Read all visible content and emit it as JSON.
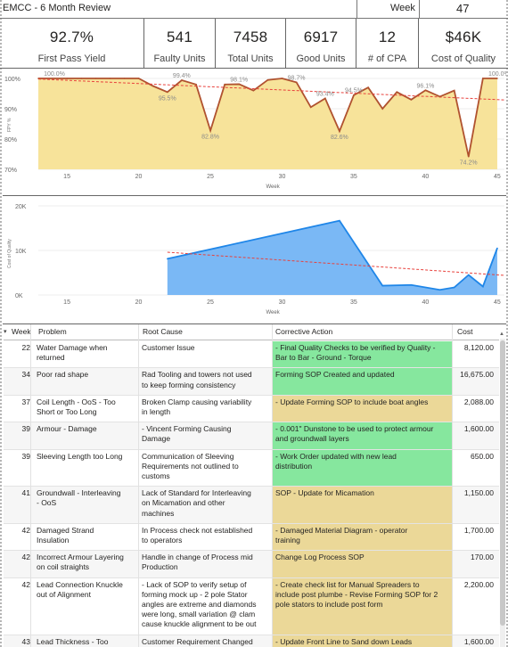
{
  "header": {
    "title": "EMCC - 6 Month Review",
    "week_label": "Week",
    "week_value": "47"
  },
  "kpis": [
    {
      "value": "92.7%",
      "label": "First Pass Yield"
    },
    {
      "value": "541",
      "label": "Faulty Units"
    },
    {
      "value": "7458",
      "label": "Total Units"
    },
    {
      "value": "6917",
      "label": "Good Units"
    },
    {
      "value": "12",
      "label": "# of CPA"
    },
    {
      "value": "$46K",
      "label": "Cost of Quality"
    }
  ],
  "colors": {
    "fpy_area": "#f7e39a",
    "fpy_line": "#b0522f",
    "trend": "#e8413c",
    "coq_area": "#7ab8f5",
    "coq_line": "#1f86e8",
    "action_green": "#86e79e",
    "action_yellow": "#ebd898"
  },
  "chart_data": [
    {
      "type": "area",
      "ylabel": "FPY %",
      "xlabel": "Week",
      "xlim": [
        13,
        45.5
      ],
      "ylim": [
        70,
        100
      ],
      "x_ticks": [
        "15",
        "20",
        "25",
        "30",
        "35",
        "40",
        "45"
      ],
      "y_ticks": [
        "100%",
        "90%",
        "80%",
        "70%"
      ],
      "trend": "dashed red line from about 99.8% (week 13) to about 93% (week 45)",
      "points": [
        {
          "x": 13,
          "y": 100.0
        },
        {
          "x": 14,
          "y": 100.0
        },
        {
          "x": 15,
          "y": 100.0
        },
        {
          "x": 16,
          "y": 100.0
        },
        {
          "x": 17,
          "y": 100.0
        },
        {
          "x": 18,
          "y": 100.0
        },
        {
          "x": 19,
          "y": 100.0
        },
        {
          "x": 20,
          "y": 100.0
        },
        {
          "x": 21,
          "y": 97.5
        },
        {
          "x": 22,
          "y": 95.5
        },
        {
          "x": 23,
          "y": 99.4
        },
        {
          "x": 24,
          "y": 98.0
        },
        {
          "x": 25,
          "y": 82.8
        },
        {
          "x": 26,
          "y": 98.0
        },
        {
          "x": 27,
          "y": 98.1
        },
        {
          "x": 28,
          "y": 96.0
        },
        {
          "x": 29,
          "y": 99.5
        },
        {
          "x": 30,
          "y": 100.0
        },
        {
          "x": 31,
          "y": 98.7
        },
        {
          "x": 32,
          "y": 90.5
        },
        {
          "x": 33,
          "y": 93.4
        },
        {
          "x": 34,
          "y": 82.6
        },
        {
          "x": 35,
          "y": 94.5
        },
        {
          "x": 36,
          "y": 97.0
        },
        {
          "x": 37,
          "y": 90.0
        },
        {
          "x": 38,
          "y": 95.5
        },
        {
          "x": 39,
          "y": 93.0
        },
        {
          "x": 40,
          "y": 96.1
        },
        {
          "x": 41,
          "y": 94.0
        },
        {
          "x": 42,
          "y": 96.0
        },
        {
          "x": 43,
          "y": 74.2
        },
        {
          "x": 44,
          "y": 100.0
        },
        {
          "x": 45,
          "y": 100.0
        }
      ],
      "labels": [
        {
          "x": 14,
          "text": "100.0%"
        },
        {
          "x": 22,
          "text": "95.5%"
        },
        {
          "x": 23,
          "text": "99.4%"
        },
        {
          "x": 25,
          "text": "82.8%"
        },
        {
          "x": 27,
          "text": "98.1%"
        },
        {
          "x": 31,
          "text": "98.7%"
        },
        {
          "x": 33,
          "text": "93.4%"
        },
        {
          "x": 34,
          "text": "82.6%"
        },
        {
          "x": 35,
          "text": "94.5%"
        },
        {
          "x": 40,
          "text": "96.1%"
        },
        {
          "x": 43,
          "text": "74.2%"
        },
        {
          "x": 45,
          "text": "100.0%"
        }
      ]
    },
    {
      "type": "area",
      "ylabel": "Cost of Quality",
      "xlabel": "Week",
      "xlim": [
        13,
        45.5
      ],
      "ylim": [
        0,
        20000
      ],
      "x_ticks": [
        "15",
        "20",
        "25",
        "30",
        "35",
        "40",
        "45"
      ],
      "y_ticks": [
        "20K",
        "10K",
        "0K"
      ],
      "trend": "dashed red line from about 9,600 (week 22) to about 4,500 (week 45)",
      "points": [
        {
          "x": 22,
          "y": 8120
        },
        {
          "x": 34,
          "y": 16675
        },
        {
          "x": 37,
          "y": 2088
        },
        {
          "x": 39,
          "y": 2250
        },
        {
          "x": 41,
          "y": 1150
        },
        {
          "x": 42,
          "y": 1700
        },
        {
          "x": 43,
          "y": 4500
        },
        {
          "x": 44,
          "y": 1900
        },
        {
          "x": 45,
          "y": 10500
        }
      ]
    }
  ],
  "table": {
    "headers": {
      "week": "Week",
      "problem": "Problem",
      "root": "Root Cause",
      "action": "Corrective Action",
      "cost": "Cost"
    },
    "rows": [
      {
        "week": "22",
        "problem": "Water Damage when\nreturned",
        "root": "Customer Issue",
        "action": "- Final Quality Checks to be verified by Quality -\nBar to Bar - Ground - Torque",
        "cost": "8,120.00",
        "status": "green"
      },
      {
        "week": "34",
        "problem": "Poor rad shape",
        "root": "Rad Tooling and towers not used\nto keep forming consistency",
        "action": "Forming SOP Created and updated",
        "cost": "16,675.00",
        "status": "green"
      },
      {
        "week": "37",
        "problem": "Coil Length - OoS - Too\nShort or Too Long",
        "root": "Broken Clamp causing variability\nin length",
        "action": "- Update Forming SOP to include boat angles",
        "cost": "2,088.00",
        "status": "yellow"
      },
      {
        "week": "39",
        "problem": "Armour - Damage",
        "root": "- Vincent Forming Causing\nDamage",
        "action": "- 0.001\" Dunstone to be used to protect armour\nand groundwall layers",
        "cost": "1,600.00",
        "status": "green"
      },
      {
        "week": "39",
        "problem": "Sleeving Length too Long",
        "root": "Communication of Sleeving\nRequirements not outlined to\ncustoms",
        "action": "- Work Order updated with new lead\ndistribution",
        "cost": "650.00",
        "status": "green"
      },
      {
        "week": "41",
        "problem": "Groundwall - Interleaving\n- OoS",
        "root": "Lack of Standard for Interleaving\non Micamation and other\nmachines",
        "action": "SOP - Update for Micamation",
        "cost": "1,150.00",
        "status": "yellow"
      },
      {
        "week": "42",
        "problem": "Damaged Strand\nInsulation",
        "root": "In Process check not established\nto operators",
        "action": "- Damaged Material Diagram - operator\ntraining",
        "cost": "1,700.00",
        "status": "yellow"
      },
      {
        "week": "42",
        "problem": "Incorrect Armour Layering\non coil straights",
        "root": "Handle in change of Process mid\nProduction",
        "action": "Change Log Process SOP",
        "cost": "170.00",
        "status": "yellow"
      },
      {
        "week": "42",
        "problem": "Lead Connection Knuckle\nout of Alignment",
        "root": "- Lack of SOP to verify setup of\nforming mock up - 2 pole Stator\nangles are extreme and diamonds\nwere long, small variation @ clam\ncause knuckle alignment to be out",
        "action": "- Create check list for Manual Spreaders to\ninclude post plumbe - Revise Forming SOP for 2\npole stators to include post form",
        "cost": "2,200.00",
        "status": "yellow"
      },
      {
        "week": "43",
        "problem": "Lead Thickness - Too\nLarge Customer Riser Slot\nCut too Small",
        "root": "Customer Requirement Changed\nafter",
        "action": "- Update Front Line to Sand down Leads",
        "cost": "1,600.00",
        "status": "yellow"
      }
    ]
  }
}
